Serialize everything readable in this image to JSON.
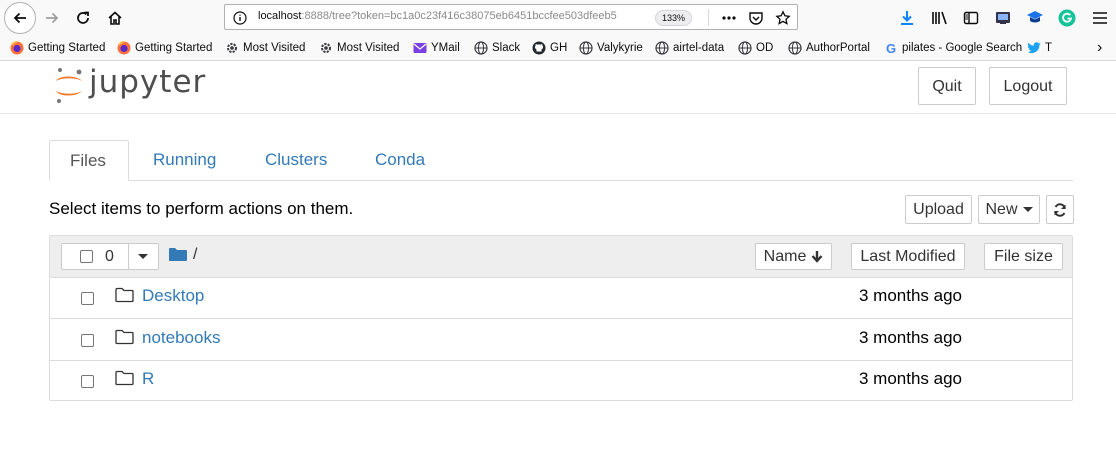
{
  "browser": {
    "url_host": "localhost",
    "url_rest": ":8888/tree?token=bc1a0c23f416c38075eb6451bccfee503dfeeb5",
    "zoom": "133%",
    "icons": [
      "back-icon",
      "forward-icon",
      "reload-icon",
      "home-icon",
      "info-icon",
      "more-icon",
      "pocket-icon",
      "star-icon",
      "download-icon",
      "library-icon",
      "sidebar-icon",
      "screenshot-icon",
      "extension-icon",
      "grammarly-icon",
      "menu-icon"
    ]
  },
  "bookmarks": [
    {
      "label": "Getting Started",
      "icon": "firefox-icon"
    },
    {
      "label": "Getting Started",
      "icon": "firefox-icon"
    },
    {
      "label": "Most Visited",
      "icon": "gear-icon"
    },
    {
      "label": "Most Visited",
      "icon": "gear-icon"
    },
    {
      "label": "YMail",
      "icon": "mail-icon"
    },
    {
      "label": "Slack",
      "icon": "globe-icon"
    },
    {
      "label": "GH",
      "icon": "github-icon"
    },
    {
      "label": "Valykyrie",
      "icon": "globe-icon"
    },
    {
      "label": "airtel-data",
      "icon": "globe-icon"
    },
    {
      "label": "OD",
      "icon": "globe-icon"
    },
    {
      "label": "AuthorPortal",
      "icon": "globe-icon"
    },
    {
      "label": "pilates - Google Search",
      "icon": "google-icon"
    },
    {
      "label": "T",
      "icon": "twitter-icon"
    }
  ],
  "jupyter": {
    "logo_text": "jupyter",
    "quit_label": "Quit",
    "logout_label": "Logout",
    "tabs": [
      "Files",
      "Running",
      "Clusters",
      "Conda"
    ],
    "active_tab": "Files",
    "hint": "Select items to perform actions on them.",
    "upload_label": "Upload",
    "new_label": "New",
    "selected_count": "0",
    "path": "/",
    "columns": {
      "name": "Name",
      "modified": "Last Modified",
      "size": "File size"
    },
    "files": [
      {
        "name": "Desktop",
        "modified": "3 months ago"
      },
      {
        "name": "notebooks",
        "modified": "3 months ago"
      },
      {
        "name": "R",
        "modified": "3 months ago"
      }
    ]
  },
  "colors": {
    "link": "#337ab7",
    "jupyter_orange": "#f37726",
    "header_bg": "#eeeeee",
    "download_blue": "#0a84ff"
  }
}
